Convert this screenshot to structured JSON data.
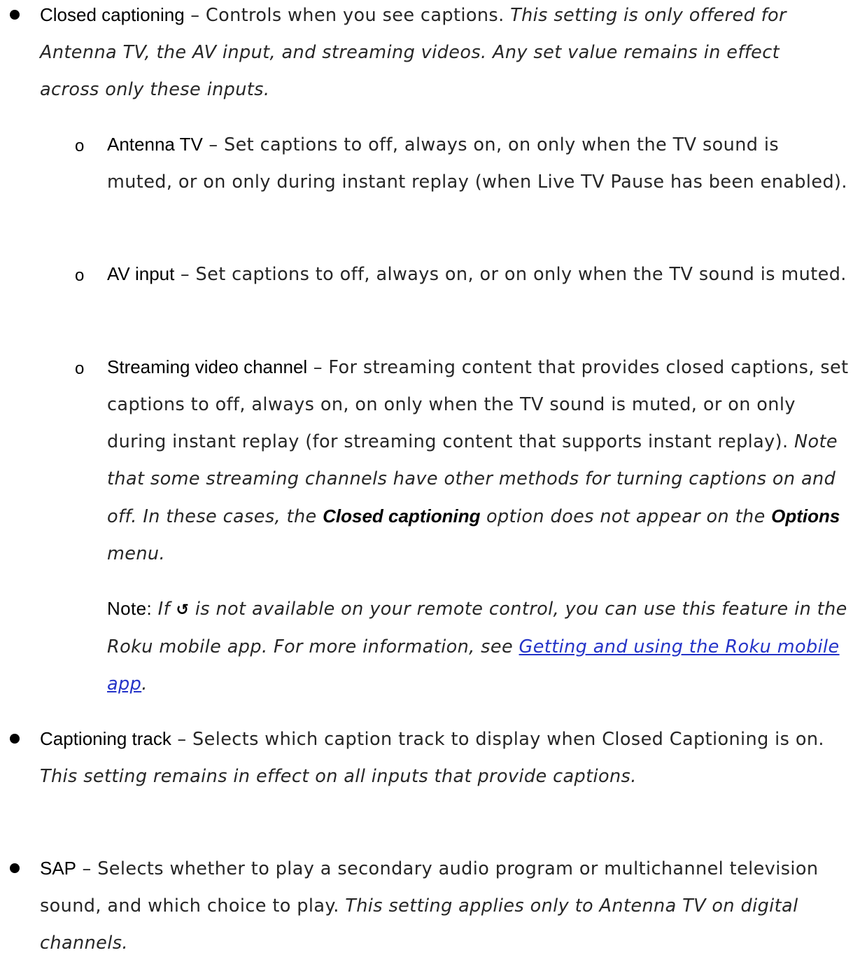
{
  "items": [
    {
      "term": "Closed captioning",
      "desc": " – Controls when you see captions. ",
      "note": "This setting is only offered for Antenna TV, the AV input, and streaming videos. Any set value remains in effect across only these inputs.",
      "subitems": [
        {
          "bullet": "o",
          "term": "Antenna TV",
          "desc": " – Set captions to off, always on, on only when the TV sound is muted, or on only during instant replay (when Live TV Pause has been enabled)."
        },
        {
          "bullet": "o",
          "term": "AV input",
          "desc": " – Set captions to off, always on, or on only when the TV sound is muted."
        },
        {
          "bullet": "o",
          "term": "Streaming video channel",
          "desc": " – For streaming content that provides closed captions, set captions to off, always on, on only when the TV sound is muted, or on only during instant replay (for streaming content that supports instant replay). ",
          "note_a": "Note that some streaming channels have other methods for turning captions on and off. In these cases, the ",
          "note_term1": "Closed captioning",
          "note_b": " option does not appear on the ",
          "note_term2": "Options",
          "note_c": " menu."
        }
      ],
      "remote_note": {
        "label": "Note:",
        "pre": " If ",
        "icon_glyph": "↺",
        "post": " is not available on your remote control, you can use this feature in the Roku mobile app. For more information, see ",
        "link": "Getting and using the Roku mobile app",
        "end": "."
      }
    },
    {
      "term": "Captioning track",
      "desc": " – Selects which caption track to display when Closed Captioning is on. ",
      "note": "This setting remains in effect on all inputs that provide captions."
    },
    {
      "term": "SAP",
      "desc": " – Selects whether to play a secondary audio program or multichannel television sound, and which choice to play. ",
      "note": "This setting applies only to Antenna TV on digital channels."
    }
  ]
}
